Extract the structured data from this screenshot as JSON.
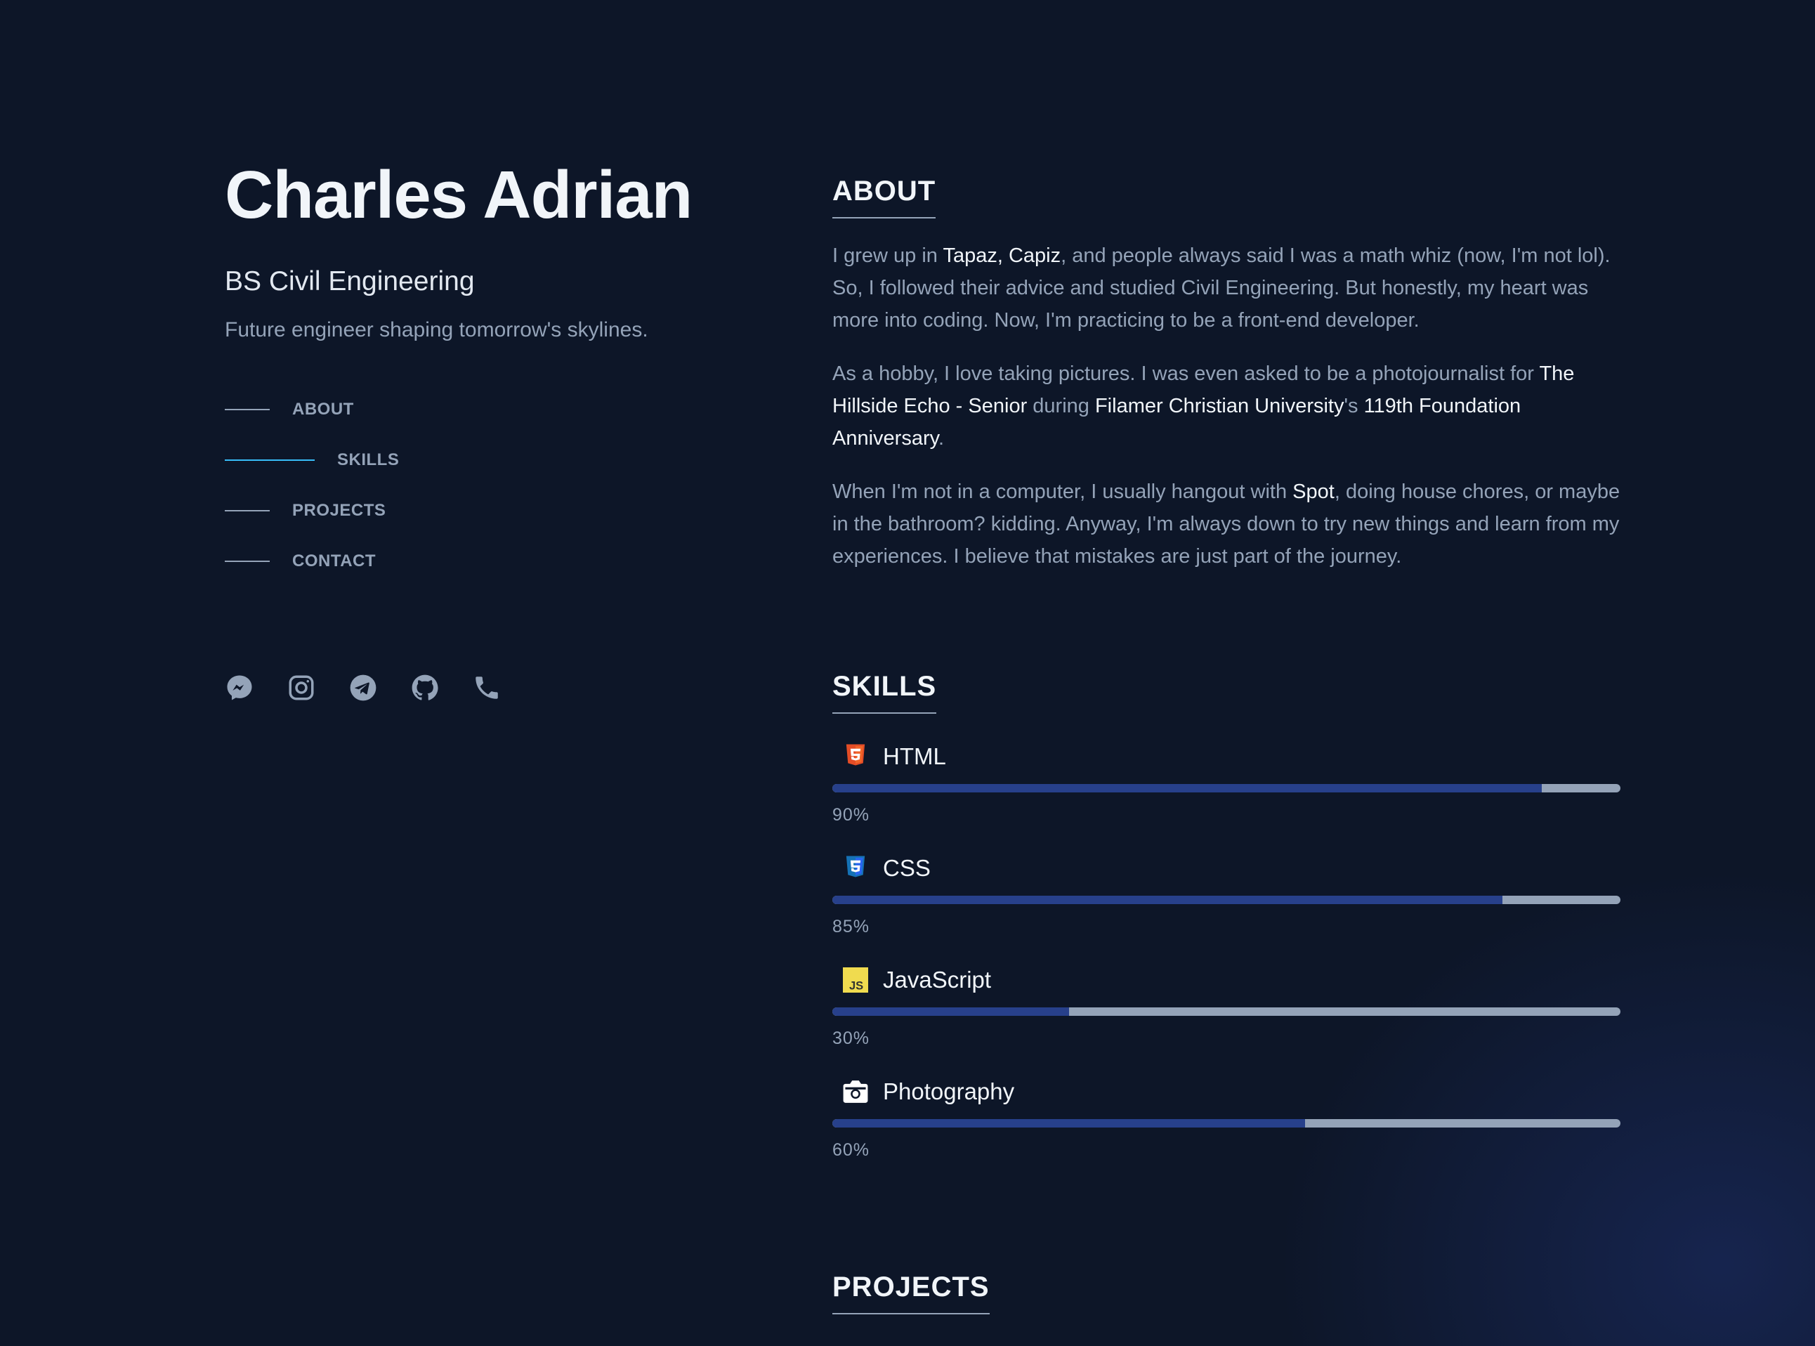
{
  "profile": {
    "name": "Charles Adrian",
    "degree": "BS Civil Engineering",
    "tagline": "Future engineer shaping tomorrow's skylines."
  },
  "nav": [
    {
      "label": "ABOUT",
      "active": false
    },
    {
      "label": "SKILLS",
      "active": true
    },
    {
      "label": "PROJECTS",
      "active": false
    },
    {
      "label": "CONTACT",
      "active": false
    }
  ],
  "socials": [
    "messenger-icon",
    "instagram-icon",
    "telegram-icon",
    "github-icon",
    "phone-icon"
  ],
  "about": {
    "title": "ABOUT",
    "p1": {
      "a": "I grew up in ",
      "b": "Tapaz, Capiz",
      "c": ", and people always said I was a math whiz (now, I'm not lol). So, I followed their advice and studied Civil Engineering. But honestly, my heart was more into coding. Now, I'm practicing to be a front-end developer."
    },
    "p2": {
      "a": "As a hobby, I love taking pictures. I was even asked to be a photojournalist for ",
      "b": "The Hillside Echo - Senior",
      "c": " during ",
      "d": "Filamer Christian University",
      "e": "'s ",
      "f": "119th Foundation Anniversary",
      "g": "."
    },
    "p3": {
      "a": "When I'm not in a computer, I usually hangout with ",
      "b": "Spot",
      "c": ", doing house chores, or maybe in the bathroom? kidding. Anyway, I'm always down to try new things and learn from my experiences. I believe that mistakes are just part of the journey."
    }
  },
  "skills": {
    "title": "SKILLS",
    "items": [
      {
        "name": "HTML",
        "percent_label": "90%",
        "level": 0.9,
        "icon": "html5-icon",
        "color": "#e44d26"
      },
      {
        "name": "CSS",
        "percent_label": "85%",
        "level": 0.85,
        "icon": "css3-icon",
        "color": "#2965f1"
      },
      {
        "name": "JavaScript",
        "percent_label": "30%",
        "level": 0.3,
        "icon": "javascript-icon",
        "color": "#f0db4f"
      },
      {
        "name": "Photography",
        "percent_label": "60%",
        "level": 0.6,
        "icon": "camera-icon",
        "color": "#ffffff"
      }
    ]
  },
  "projects": {
    "title": "PROJECTS"
  },
  "colors": {
    "background": "#0d1628",
    "accent": "#38bdf8",
    "bar_fill": "#27408b",
    "bar_track": "#94a3b8",
    "text_muted": "#94a3b8",
    "text_bright": "#f1f5f9"
  }
}
